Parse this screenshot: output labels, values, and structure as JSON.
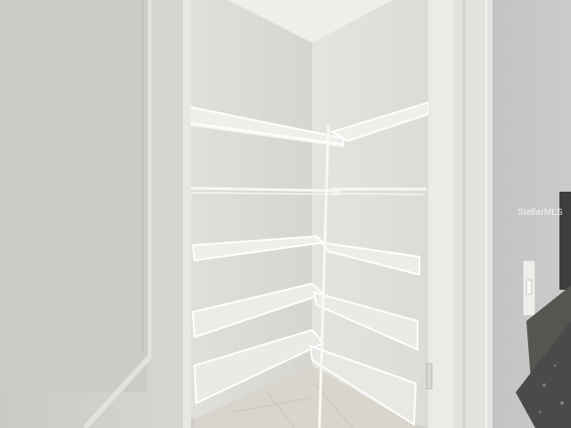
{
  "watermark": {
    "text": "StellarMLS"
  },
  "colors": {
    "door": "#d2d2cf",
    "pantry_wall_left": "#dcdcd8",
    "pantry_wall_right": "#e6e6e2",
    "ceiling": "#ebebe7",
    "shelf_wire": "#f4f4f1",
    "hallway_wall": "#c6c8c8",
    "granite": "#4a4a48",
    "tile_floor": "#d8d4cc"
  }
}
